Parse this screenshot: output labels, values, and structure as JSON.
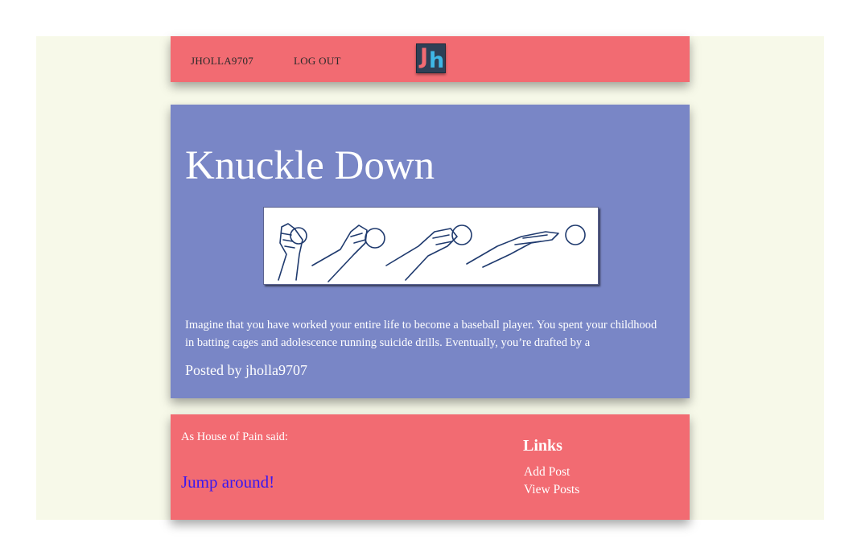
{
  "nav": {
    "username": "JHOLLA9707",
    "logout_label": "LOG OUT",
    "logo_letter_j": "J",
    "logo_letter_h": "h"
  },
  "post": {
    "title": "Knuckle Down",
    "excerpt": "Imagine that you have worked your entire life to become a baseball player. You spent your childhood in batting cages and adolescence running suicide drills. Eventually, you’re drafted by a",
    "author_line": "Posted by jholla9707"
  },
  "footer": {
    "quote_intro": "As House of Pain said:",
    "quote_link": "Jump around!",
    "links_heading": "Links",
    "links": [
      {
        "label": "Add Post"
      },
      {
        "label": "View Posts"
      }
    ]
  },
  "colors": {
    "background": "#f7f9e9",
    "coral": "#f26b72",
    "periwinkle": "#7986c6",
    "link_blue": "#3a17f0",
    "logo_navy": "#2e4056"
  }
}
